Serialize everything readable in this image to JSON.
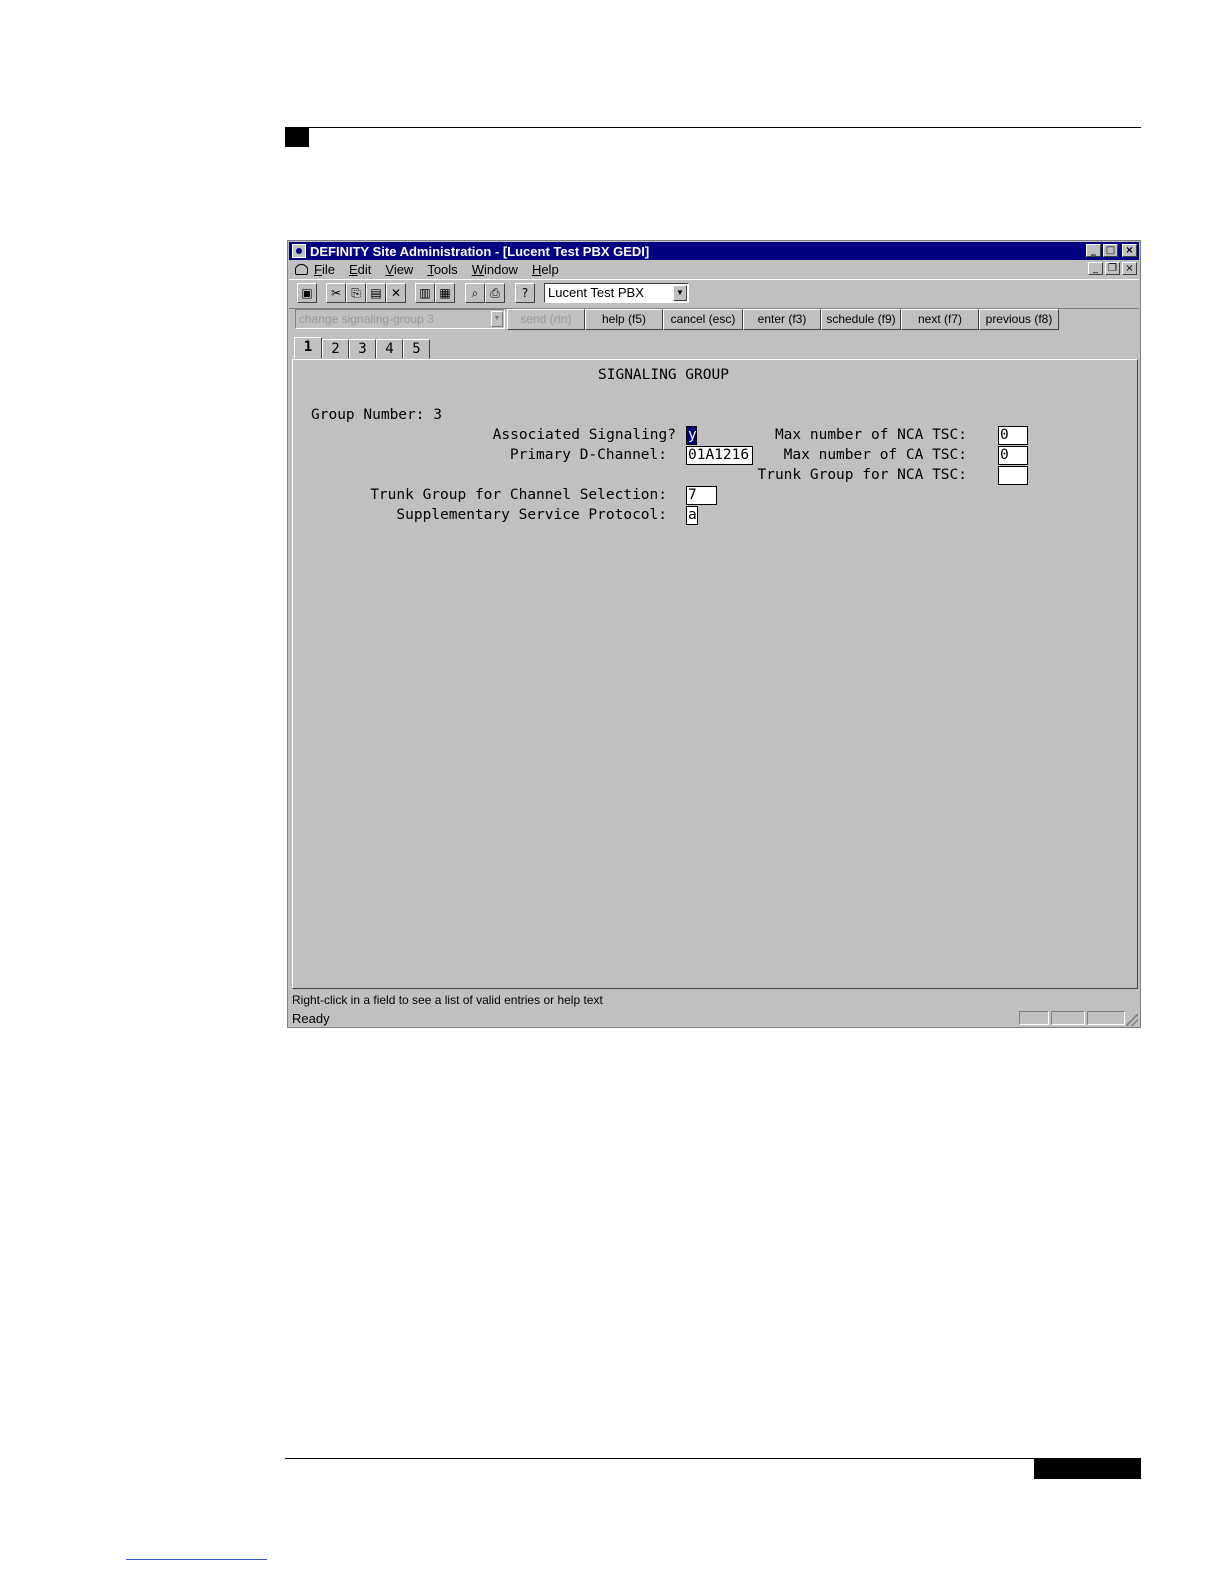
{
  "window": {
    "title": "DEFINITY Site Administration - [Lucent Test PBX GEDI]",
    "caption_buttons": {
      "minimize": "_",
      "maximize": "□",
      "close": "×"
    },
    "mdi_buttons": {
      "minimize": "_",
      "restore": "❐",
      "close": "×"
    }
  },
  "menu": {
    "items": [
      "File",
      "Edit",
      "View",
      "Tools",
      "Window",
      "Help"
    ]
  },
  "toolbar": {
    "icons": {
      "save": "▣",
      "cut": "✂",
      "copy": "⎘",
      "paste": "▤",
      "delete": "✕",
      "list1": "▥",
      "list2": "▦",
      "preview": "⌕",
      "print": "⎙",
      "help": "?"
    },
    "connection_value": "Lucent Test PBX",
    "combo_arrow": "▼"
  },
  "command": {
    "value": "change signaling-group 3",
    "arrow": "▼",
    "buttons": [
      "send (rtn)",
      "help (f5)",
      "cancel (esc)",
      "enter (f3)",
      "schedule (f9)",
      "next (f7)",
      "previous (f8)"
    ]
  },
  "tabs": [
    "1",
    "2",
    "3",
    "4",
    "5"
  ],
  "form": {
    "heading": "SIGNALING GROUP",
    "group_number": "Group Number: 3",
    "associated_signaling_label": "Associated Signaling?",
    "associated_signaling_value": "y",
    "primary_dchannel_label": "Primary D-Channel:",
    "primary_dchannel_value": "01A1216",
    "trunk_group_label": "Trunk Group for Channel Selection:",
    "trunk_group_value": "7",
    "supp_protocol_label": "Supplementary Service Protocol:",
    "supp_protocol_value": "a",
    "max_nca_label": "Max number of NCA TSC:",
    "max_nca_value": "0",
    "max_ca_label": "Max number of CA TSC:",
    "max_ca_value": "0",
    "trunk_nca_label": "Trunk Group for NCA TSC:",
    "trunk_nca_value": ""
  },
  "status": {
    "hint": "Right-click in a field to see a list of valid entries or help text",
    "ready": "Ready"
  }
}
